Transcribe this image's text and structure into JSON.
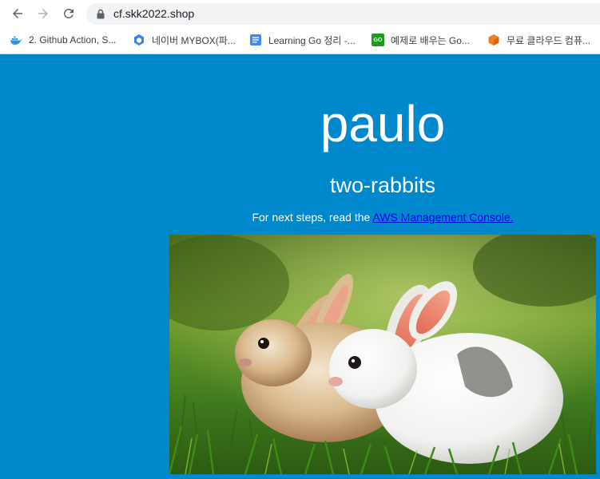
{
  "browser": {
    "url": "cf.skk2022.shop",
    "bookmarks": [
      {
        "label": "2. Github Action, S...",
        "icon": "docker-whale-icon"
      },
      {
        "label": "네이버 MYBOX(파...",
        "icon": "mybox-cube-icon"
      },
      {
        "label": "Learning Go 정리 -...",
        "icon": "google-docs-icon"
      },
      {
        "label": "예제로 배우는 Go...",
        "icon": "go-badge-icon",
        "icon_text": "GO"
      },
      {
        "label": "무료 클라우드 컴퓨...",
        "icon": "orange-box-icon"
      }
    ]
  },
  "page": {
    "title": "paulo",
    "subtitle": "two-rabbits",
    "steps_prefix": "For next steps, read the ",
    "steps_link": "AWS Management Console."
  },
  "colors": {
    "page_background": "#0088cc",
    "text": "#ffffff",
    "link": "#0000ee"
  }
}
